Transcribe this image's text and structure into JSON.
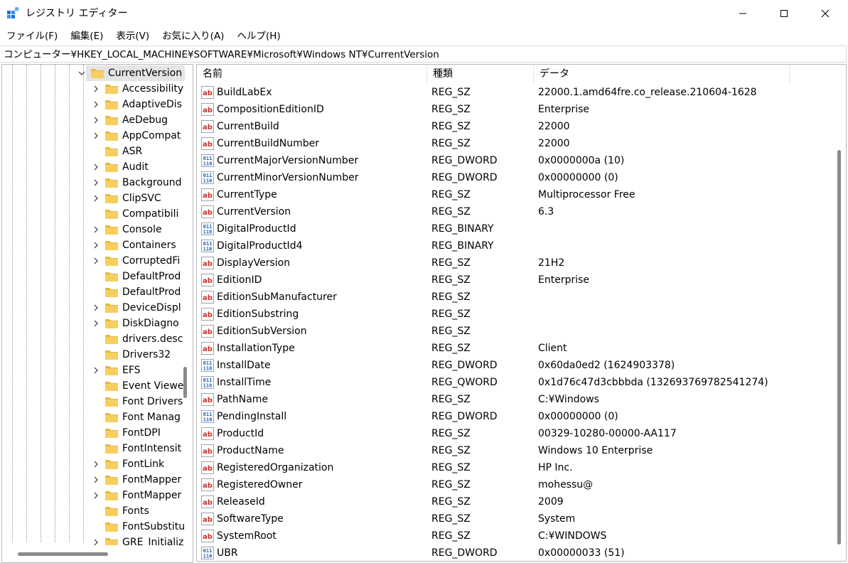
{
  "window": {
    "title": "レジストリ エディター",
    "minimize_glyph": "—",
    "maximize_glyph": "☐",
    "close_glyph": "✕"
  },
  "menu": [
    "ファイル(F)",
    "編集(E)",
    "表示(V)",
    "お気に入り(A)",
    "ヘルプ(H)"
  ],
  "address": "コンピューター¥HKEY_LOCAL_MACHINE¥SOFTWARE¥Microsoft¥Windows NT¥CurrentVersion",
  "tree": {
    "selected": "CurrentVersion",
    "children": [
      {
        "label": "Accessibility",
        "expandable": true
      },
      {
        "label": "AdaptiveDis",
        "expandable": true
      },
      {
        "label": "AeDebug",
        "expandable": true
      },
      {
        "label": "AppCompat",
        "expandable": true
      },
      {
        "label": "ASR",
        "expandable": false
      },
      {
        "label": "Audit",
        "expandable": true
      },
      {
        "label": "Background",
        "expandable": true
      },
      {
        "label": "ClipSVC",
        "expandable": true
      },
      {
        "label": "Compatibili",
        "expandable": false
      },
      {
        "label": "Console",
        "expandable": true
      },
      {
        "label": "Containers",
        "expandable": true
      },
      {
        "label": "CorruptedFi",
        "expandable": true
      },
      {
        "label": "DefaultProd",
        "expandable": false
      },
      {
        "label": "DefaultProd",
        "expandable": false
      },
      {
        "label": "DeviceDispl",
        "expandable": true
      },
      {
        "label": "DiskDiagno",
        "expandable": true
      },
      {
        "label": "drivers.desc",
        "expandable": false
      },
      {
        "label": "Drivers32",
        "expandable": false
      },
      {
        "label": "EFS",
        "expandable": true
      },
      {
        "label": "Event Viewe",
        "expandable": false
      },
      {
        "label": "Font Drivers",
        "expandable": false
      },
      {
        "label": "Font Manag",
        "expandable": false
      },
      {
        "label": "FontDPI",
        "expandable": false
      },
      {
        "label": "FontIntensit",
        "expandable": false
      },
      {
        "label": "FontLink",
        "expandable": true
      },
      {
        "label": "FontMapper",
        "expandable": true
      },
      {
        "label": "FontMapper",
        "expandable": true
      },
      {
        "label": "Fonts",
        "expandable": false
      },
      {
        "label": "FontSubstitu",
        "expandable": false
      },
      {
        "label": "GRE_Initializ",
        "expandable": true
      }
    ]
  },
  "columns": {
    "name": "名前",
    "type": "種類",
    "data": "データ"
  },
  "values": [
    {
      "name": "BuildLabEx",
      "type": "REG_SZ",
      "data": "22000.1.amd64fre.co_release.210604-1628",
      "icon": "string-value-icon"
    },
    {
      "name": "CompositionEditionID",
      "type": "REG_SZ",
      "data": "Enterprise",
      "icon": "string-value-icon"
    },
    {
      "name": "CurrentBuild",
      "type": "REG_SZ",
      "data": "22000",
      "icon": "string-value-icon"
    },
    {
      "name": "CurrentBuildNumber",
      "type": "REG_SZ",
      "data": "22000",
      "icon": "string-value-icon"
    },
    {
      "name": "CurrentMajorVersionNumber",
      "type": "REG_DWORD",
      "data": "0x0000000a (10)",
      "icon": "binary-value-icon"
    },
    {
      "name": "CurrentMinorVersionNumber",
      "type": "REG_DWORD",
      "data": "0x00000000 (0)",
      "icon": "binary-value-icon"
    },
    {
      "name": "CurrentType",
      "type": "REG_SZ",
      "data": "Multiprocessor Free",
      "icon": "string-value-icon"
    },
    {
      "name": "CurrentVersion",
      "type": "REG_SZ",
      "data": "6.3",
      "icon": "string-value-icon"
    },
    {
      "name": "DigitalProductId",
      "type": "REG_BINARY",
      "data": "",
      "icon": "binary-value-icon"
    },
    {
      "name": "DigitalProductId4",
      "type": "REG_BINARY",
      "data": "",
      "icon": "binary-value-icon"
    },
    {
      "name": "DisplayVersion",
      "type": "REG_SZ",
      "data": "21H2",
      "icon": "string-value-icon"
    },
    {
      "name": "EditionID",
      "type": "REG_SZ",
      "data": "Enterprise",
      "icon": "string-value-icon"
    },
    {
      "name": "EditionSubManufacturer",
      "type": "REG_SZ",
      "data": "",
      "icon": "string-value-icon"
    },
    {
      "name": "EditionSubstring",
      "type": "REG_SZ",
      "data": "",
      "icon": "string-value-icon"
    },
    {
      "name": "EditionSubVersion",
      "type": "REG_SZ",
      "data": "",
      "icon": "string-value-icon"
    },
    {
      "name": "InstallationType",
      "type": "REG_SZ",
      "data": "Client",
      "icon": "string-value-icon"
    },
    {
      "name": "InstallDate",
      "type": "REG_DWORD",
      "data": "0x60da0ed2 (1624903378)",
      "icon": "binary-value-icon"
    },
    {
      "name": "InstallTime",
      "type": "REG_QWORD",
      "data": "0x1d76c47d3cbbbda (132693769782541274)",
      "icon": "binary-value-icon"
    },
    {
      "name": "PathName",
      "type": "REG_SZ",
      "data": "C:¥Windows",
      "icon": "string-value-icon"
    },
    {
      "name": "PendingInstall",
      "type": "REG_DWORD",
      "data": "0x00000000 (0)",
      "icon": "binary-value-icon"
    },
    {
      "name": "ProductId",
      "type": "REG_SZ",
      "data": "00329-10280-00000-AA117",
      "icon": "string-value-icon"
    },
    {
      "name": "ProductName",
      "type": "REG_SZ",
      "data": "Windows 10 Enterprise",
      "icon": "string-value-icon"
    },
    {
      "name": "RegisteredOrganization",
      "type": "REG_SZ",
      "data": "HP Inc.",
      "icon": "string-value-icon"
    },
    {
      "name": "RegisteredOwner",
      "type": "REG_SZ",
      "data": "mohessu@",
      "icon": "string-value-icon"
    },
    {
      "name": "ReleaseId",
      "type": "REG_SZ",
      "data": "2009",
      "icon": "string-value-icon"
    },
    {
      "name": "SoftwareType",
      "type": "REG_SZ",
      "data": "System",
      "icon": "string-value-icon"
    },
    {
      "name": "SystemRoot",
      "type": "REG_SZ",
      "data": "C:¥WINDOWS",
      "icon": "string-value-icon"
    },
    {
      "name": "UBR",
      "type": "REG_DWORD",
      "data": "0x00000033 (51)",
      "icon": "binary-value-icon"
    }
  ],
  "colors": {
    "folder": "#f2c14e",
    "string_icon": "#c8322a",
    "binary_icon": "#1f5fbf",
    "accent": "#0078d4"
  }
}
